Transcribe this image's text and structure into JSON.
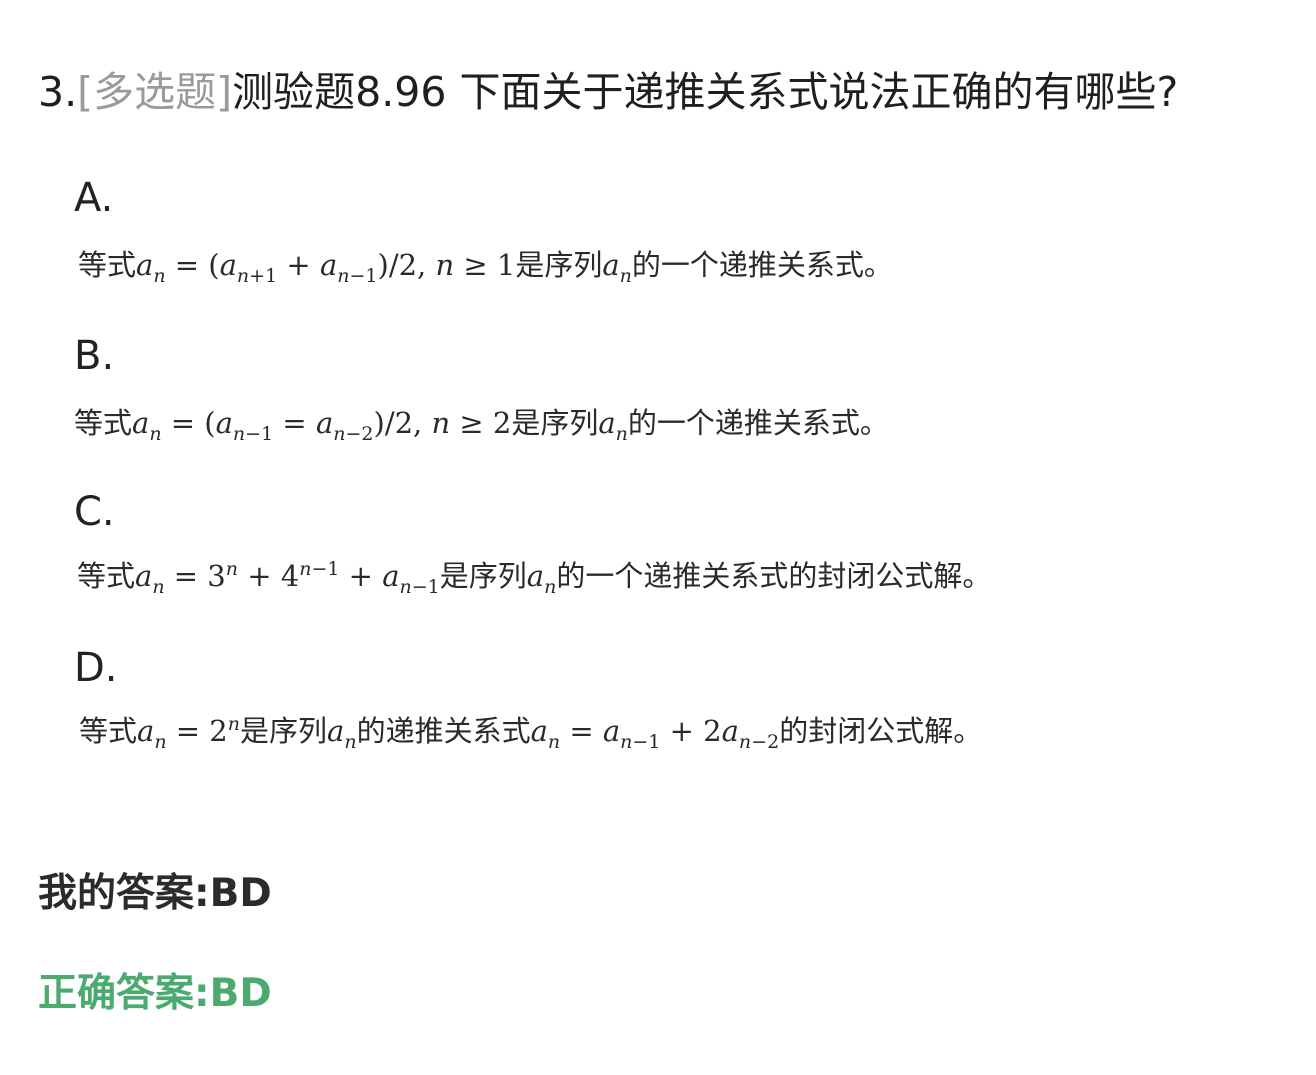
{
  "question": {
    "number": "3.",
    "type": "[多选题]",
    "text": "测验题8.96 下面关于递推关系式说法正确的有哪些?"
  },
  "options": [
    {
      "letter": "A."
    },
    {
      "letter": "B."
    },
    {
      "letter": "C."
    },
    {
      "letter": "D."
    }
  ],
  "option_text": {
    "a": {
      "prefix": "等式",
      "mid": "是序列",
      "suffix": "的一个递推关系式。"
    },
    "b": {
      "prefix": "等式",
      "mid": "是序列",
      "suffix": "的一个递推关系式。"
    },
    "c": {
      "prefix": "等式",
      "mid": "是序列",
      "suffix": "的一个递推关系式的封闭公式解。"
    },
    "d": {
      "prefix": "等式",
      "mid": "是序列",
      "mid2": "的递推关系式",
      "suffix": "的封闭公式解。"
    }
  },
  "my_answer": {
    "label": "我的答案:",
    "value": "BD"
  },
  "correct_answer": {
    "label": "正确答案:",
    "value": "BD"
  },
  "colors": {
    "question_type": "#9a9a9a",
    "correct": "#4aaa6f",
    "text": "#222222"
  }
}
